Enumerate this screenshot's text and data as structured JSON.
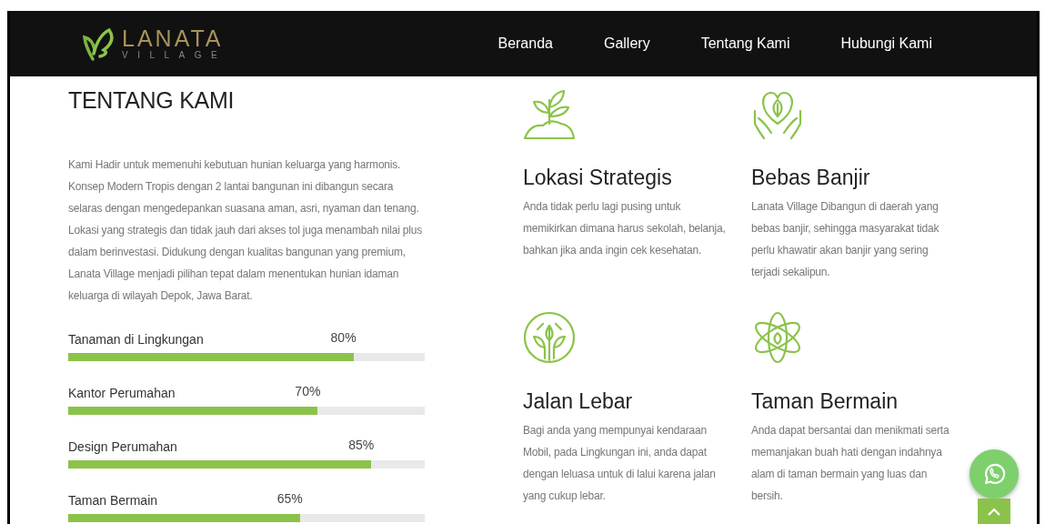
{
  "nav": {
    "logo": {
      "name": "LANATA",
      "tagline": "VILLAGE"
    },
    "links": [
      {
        "label": "Beranda"
      },
      {
        "label": "Gallery"
      },
      {
        "label": "Tentang Kami"
      },
      {
        "label": "Hubungi Kami"
      }
    ]
  },
  "about": {
    "title": "TENTANG KAMI",
    "text": "Kami Hadir untuk memenuhi kebutuan hunian keluarga yang harmonis. Konsep Modern Tropis dengan 2 lantai bangunan ini dibangun secara selaras dengan mengedepankan suasana aman, asri, nyaman dan tenang. Lokasi yang strategis dan tidak jauh dari akses tol juga menambah nilai plus dalam berinvestasi. Didukung dengan kualitas bangunan yang premium, Lanata Village menjadi pilihan tepat dalam menentukan hunian idaman keluarga di wilayah Depok, Jawa Barat.",
    "skills": [
      {
        "label": "Tanaman di Lingkungan",
        "percent": "80%",
        "level": 0.8
      },
      {
        "label": "Kantor Perumahan",
        "percent": "70%",
        "level": 0.7
      },
      {
        "label": "Design Perumahan",
        "percent": "85%",
        "level": 0.85
      },
      {
        "label": "Taman Bermain",
        "percent": "65%",
        "level": 0.65
      }
    ]
  },
  "features": [
    {
      "kind": "sprout",
      "title": "Lokasi Strategis",
      "text": "Anda tidak perlu lagi pusing untuk memikirkan dimana harus sekolah, belanja, bahkan jika anda ingin cek kesehatan."
    },
    {
      "kind": "heart",
      "title": "Bebas Banjir",
      "text": "Lanata Village Dibangun di daerah yang bebas banjir, sehingga masyarakat tidak perlu khawatir akan banjir yang sering terjadi sekalipun."
    },
    {
      "kind": "tree",
      "title": "Jalan Lebar",
      "text": "Bagi anda yang mempunyai kendaraan Mobil, pada Lingkungan ini, anda dapat dengan leluasa untuk di lalui karena jalan yang cukup lebar."
    },
    {
      "kind": "atom",
      "title": "Taman Bermain",
      "text": "Anda dapat bersantai dan menikmati serta memanjakan buah hati dengan indahnya alam di taman bermain yang luas dan bersih."
    }
  ]
}
